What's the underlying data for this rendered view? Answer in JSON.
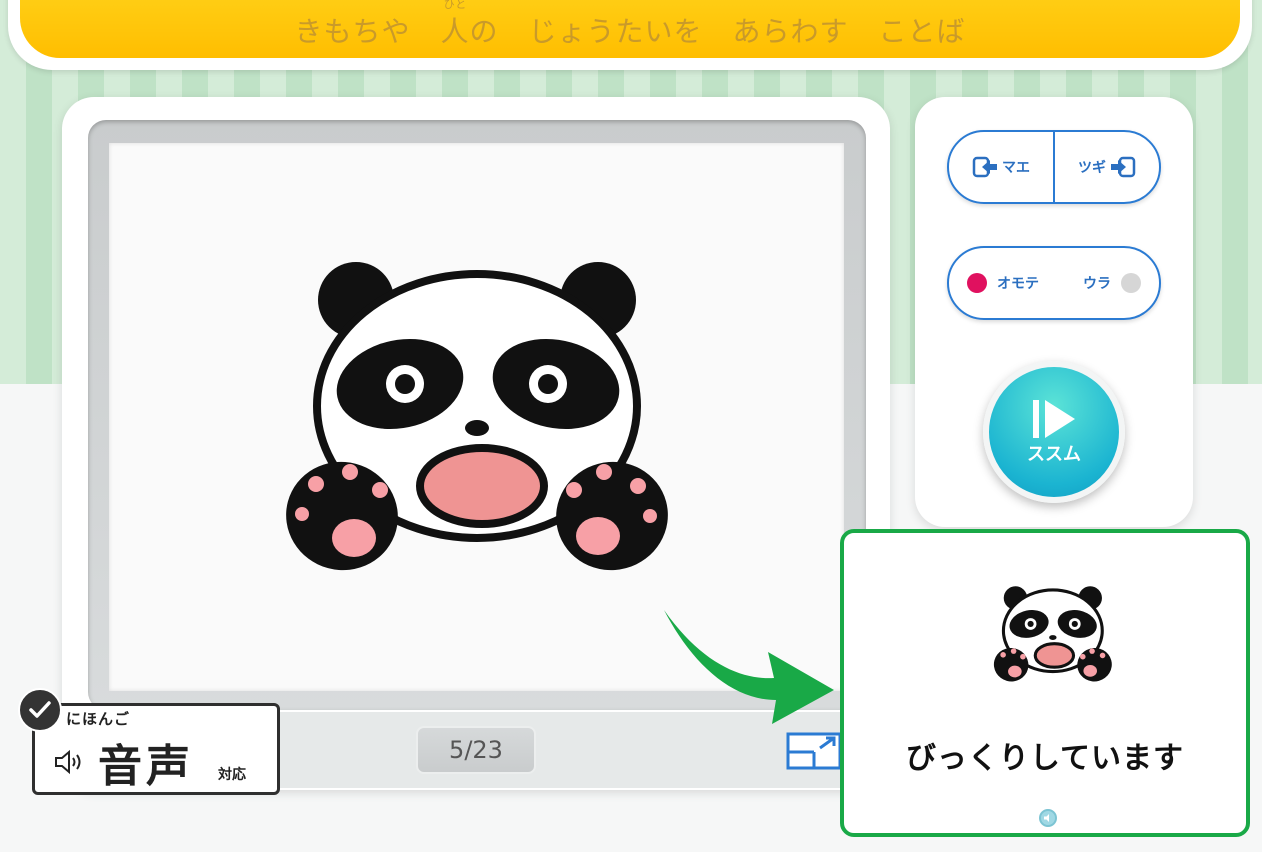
{
  "header": {
    "title_parts": [
      "きもちや",
      "人の",
      "じょうたいを",
      "あらわす",
      "ことば"
    ],
    "ruby": "ひと"
  },
  "viewer": {
    "counter": "5/23",
    "illustration": "panda-surprised"
  },
  "controls": {
    "prev_label": "マエ",
    "next_label": "ツギ",
    "front_label": "オモテ",
    "back_label": "ウラ",
    "go_label": "ススム",
    "front_active": true
  },
  "card": {
    "text": "びっくりしています",
    "illustration": "panda-surprised-small"
  },
  "badge": {
    "ruby": "にほんご",
    "main": "音声",
    "small": "対応"
  },
  "colors": {
    "header_yellow": "#ffc60b",
    "nav_blue": "#2b7bd3",
    "go_teal": "#1bb4d1",
    "card_green": "#19a947",
    "active_dot": "#e0115f",
    "inactive_dot": "#d6d6d6"
  },
  "icons": [
    "prev-arrow-icon",
    "next-arrow-icon",
    "play-next-icon",
    "expand-icon",
    "speaker-icon",
    "check-icon",
    "sound-icon"
  ]
}
